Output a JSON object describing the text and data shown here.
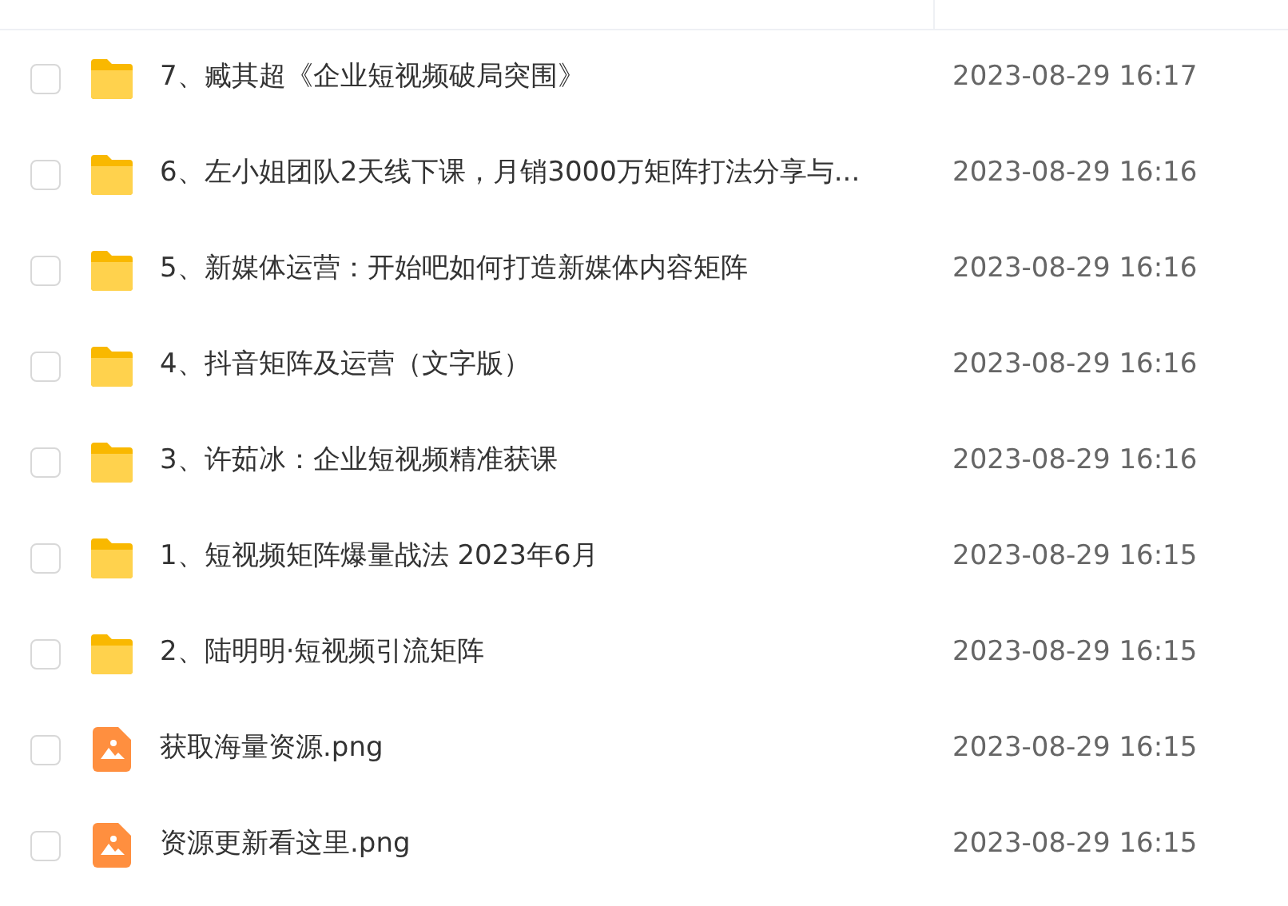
{
  "files": [
    {
      "kind": "folder",
      "name": "7、臧其超《企业短视频破局突围》",
      "modified": "2023-08-29 16:17",
      "checked": false
    },
    {
      "kind": "folder",
      "name": "6、左小姐团队2天线下课，月销3000万矩阵打法分享与...",
      "modified": "2023-08-29 16:16",
      "checked": false
    },
    {
      "kind": "folder",
      "name": "5、新媒体运营：开始吧如何打造新媒体内容矩阵",
      "modified": "2023-08-29 16:16",
      "checked": false
    },
    {
      "kind": "folder",
      "name": "4、抖音矩阵及运营（文字版）",
      "modified": "2023-08-29 16:16",
      "checked": false
    },
    {
      "kind": "folder",
      "name": "3、许茹冰：企业短视频精准获课",
      "modified": "2023-08-29 16:16",
      "checked": false
    },
    {
      "kind": "folder",
      "name": "1、短视频矩阵爆量战法 2023年6月",
      "modified": "2023-08-29 16:15",
      "checked": false
    },
    {
      "kind": "folder",
      "name": "2、陆明明·短视频引流矩阵",
      "modified": "2023-08-29 16:15",
      "checked": false
    },
    {
      "kind": "image",
      "name": "获取海量资源.png",
      "modified": "2023-08-29 16:15",
      "checked": false
    },
    {
      "kind": "image",
      "name": "资源更新看这里.png",
      "modified": "2023-08-29 16:15",
      "checked": false
    }
  ]
}
